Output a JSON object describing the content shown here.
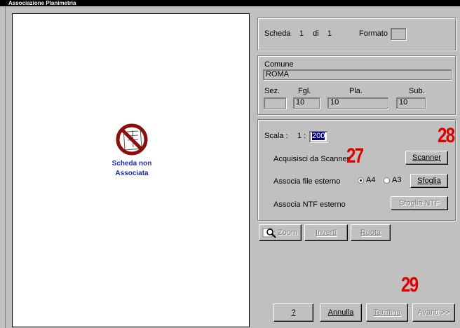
{
  "window": {
    "title": "Associazione Planimetria"
  },
  "preview": {
    "status_line1": "Scheda non",
    "status_line2": "Associata"
  },
  "scheda": {
    "label": "Scheda",
    "current": "1",
    "di": "di",
    "total": "1",
    "formato_label": "Formato",
    "formato_value": ""
  },
  "comune": {
    "label": "Comune",
    "value": "ROMA",
    "sez_label": "Sez.",
    "sez_value": "",
    "fgl_label": "Fgl.",
    "fgl_value": "10",
    "pla_label": "Pla.",
    "pla_value": "10",
    "sub_label": "Sub.",
    "sub_value": "10"
  },
  "acquisizione": {
    "scala_label": "Scala :",
    "scala_prefix": "1 :",
    "scala_value": "200",
    "scanner_label": "Acquisisci da Scanner",
    "scanner_button": "Scanner",
    "file_label": "Associa file esterno",
    "radio_a4": "A4",
    "radio_a3": "A3",
    "selected_format": "A4",
    "sfoglia_button": "Sfoglia",
    "ntf_label": "Associa NTF esterno",
    "ntf_button": "Sfoglia NTF"
  },
  "view_buttons": {
    "zoom": "Zoom",
    "inverti": "Inverti",
    "ruota": "Ruota"
  },
  "footer_buttons": {
    "help": "?",
    "annulla": "Annulla",
    "termina": "Termina",
    "avanti": "Avanti >>"
  },
  "callouts": {
    "c27": "27",
    "c28": "28",
    "c29": "29"
  }
}
